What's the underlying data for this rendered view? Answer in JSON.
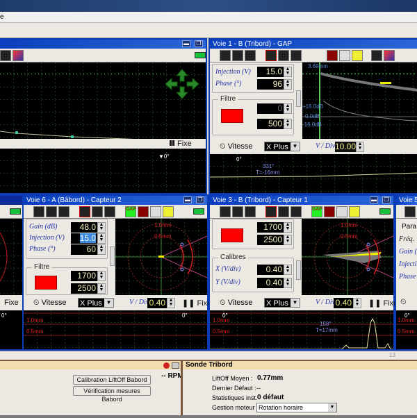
{
  "menu": {
    "partial_item": "e"
  },
  "panel_topleft": {
    "fixe": "Fixe"
  },
  "panel_voie1": {
    "title": "Voie 1 - B (Tribord) - GAP",
    "injection_label": "Injection (V)",
    "injection": "15.0",
    "phase_label": "Phase (°)",
    "phase": "96",
    "filtre_label": "Filtre",
    "filtre_low": "0",
    "filtre_high": "500",
    "scope_top": "3.69mm",
    "db_hi": "+16.0dB",
    "db_mid": "0.0dB",
    "db_lo": "-16.0dB",
    "vitesse": "Vitesse",
    "mode": "X Plus",
    "vdiv_label": "V / Div",
    "vdiv": "10.00",
    "marker0": "0°",
    "angle": "331°",
    "t": "T=-16mm"
  },
  "panel_voie6": {
    "title": "Voie 6 - A (Bâbord) - Capteur 2",
    "gain_label": "Gain (dB)",
    "gain": "48.0",
    "injection_label": "Injection (V)",
    "injection": "15.0",
    "phase_label": "Phase (°)",
    "phase": "60",
    "filtre_label": "Filtre",
    "filtre_low": "1700",
    "filtre_high": "2500",
    "gap": "GAP",
    "r1": "1.0mm",
    "r2": "0.5mm",
    "vitesse": "Vitesse",
    "mode": "X Plus",
    "vdiv_label": "V / Div",
    "vdiv": "0.40",
    "fixe": "Fixe",
    "marker0": "0°",
    "s1": "1.0mm",
    "s2": "0.5mm",
    "left_fixe": "Fixe",
    "left_marker": "0°"
  },
  "panel_voie3": {
    "title": "Voie 3 - B (Tribord) - Capteur 1",
    "filtre_low": "1700",
    "filtre_high": "2500",
    "calibres_label": "Calibres",
    "x_label": "X (V/div)",
    "x": "0.40",
    "y_label": "Y (V/div)",
    "y": "0.40",
    "gap": "GAP",
    "r1": "1.0mm",
    "r2": "0.5mm",
    "vitesse": "Vitesse",
    "mode": "X Plus",
    "vdiv_label": "V / Div",
    "vdiv": "0.40",
    "fixe": "Fixe",
    "marker0": "0°",
    "s1": "1.0mm",
    "s2": "0.5mm",
    "angle": "158°",
    "t": "T=17mm"
  },
  "panel_voie5": {
    "title": "Voie 5 -",
    "param_label": "Para",
    "freq": "Fréq.",
    "gain": "Gain (",
    "injection": "Injecti",
    "phase": "Phase",
    "marker0": "0°",
    "s1": "1.0mm",
    "s2": "0.5mm"
  },
  "statusbar": {
    "page": "13"
  },
  "bottom": {
    "calib_button": "Calibration LiftOff Babord",
    "verif_button": "Vérification mesures Babord",
    "rpm": "-- RPM",
    "sonde_title": "Sonde Tribord",
    "liftoff_label": "LiftOff Moyen :",
    "liftoff": "0.77mm",
    "defaut_label": "Dernier Défaut :",
    "defaut": "--",
    "stats_label": "Statistiques inst.",
    "stats": "0 défaut",
    "moteur_label": "Gestion moteur :",
    "moteur": "Rotation horaire"
  }
}
